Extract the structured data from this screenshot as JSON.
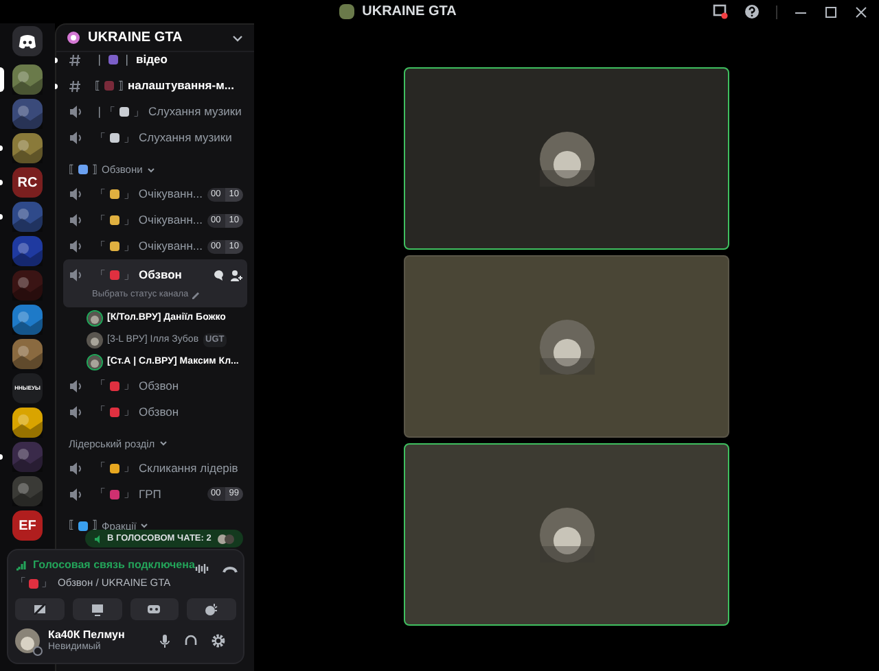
{
  "window": {
    "title": "UKRAINE GTA"
  },
  "servers": [
    {
      "kind": "home",
      "selected": false,
      "unread": false
    },
    {
      "kind": "art",
      "color": "#6a7a4a",
      "selected": true
    },
    {
      "kind": "art",
      "color": "#3a4a7a",
      "selected": false,
      "unread": false
    },
    {
      "kind": "art",
      "color": "#8a7a3a",
      "selected": false,
      "unread": true
    },
    {
      "kind": "label",
      "label": "RC",
      "color": "#7a1f1f",
      "selected": false,
      "unread": true
    },
    {
      "kind": "art",
      "color": "#2f4a8a",
      "selected": false,
      "unread": true
    },
    {
      "kind": "art",
      "color": "#1f3aa0",
      "selected": false,
      "unread": false
    },
    {
      "kind": "art",
      "color": "#3a1414",
      "selected": false,
      "unread": false
    },
    {
      "kind": "art",
      "color": "#1e7ac8",
      "selected": false,
      "unread": false
    },
    {
      "kind": "art",
      "color": "#8a6a40",
      "selected": false,
      "unread": false
    },
    {
      "kind": "label",
      "label": "ННЫЕУЫ",
      "color": "#1e1f22",
      "selected": false,
      "unread": false
    },
    {
      "kind": "art",
      "color": "#d9a400",
      "selected": false,
      "unread": false
    },
    {
      "kind": "art",
      "color": "#3a2a4a",
      "selected": false,
      "unread": true
    },
    {
      "kind": "art",
      "color": "#3a3a36",
      "selected": false,
      "unread": false
    },
    {
      "kind": "label",
      "label": "EF",
      "color": "#b01e1e",
      "selected": false,
      "unread": false
    }
  ],
  "guild": {
    "name": "UKRAINE GTA"
  },
  "channels": [
    {
      "kind": "text",
      "left": "❘",
      "color": "#7c5fc8",
      "right": "❘",
      "name": "відео",
      "unread": true
    },
    {
      "kind": "text",
      "left": "⟦",
      "color": "#7a2a3a",
      "right": "⟧",
      "name": "налаштування-м...",
      "unread": true
    },
    {
      "kind": "voice",
      "left": "❘「",
      "color": "#c9cdd3",
      "right": "」",
      "name": "Слухання музики"
    },
    {
      "kind": "voice",
      "left": "「",
      "color": "#c9cdd3",
      "right": "」",
      "name": "Слухання музики"
    },
    {
      "kind": "category",
      "left": "⟦",
      "color": "#6aa0f0",
      "right": "⟧",
      "name": "Обзвони"
    },
    {
      "kind": "voice",
      "left": "「",
      "color": "#e0b040",
      "right": "」",
      "name": "Очікуванн...",
      "counter": [
        "00",
        "10"
      ]
    },
    {
      "kind": "voice",
      "left": "「",
      "color": "#e0b040",
      "right": "」",
      "name": "Очікуванн...",
      "counter": [
        "00",
        "10"
      ]
    },
    {
      "kind": "voice",
      "left": "「",
      "color": "#e0b040",
      "right": "」",
      "name": "Очікуванн...",
      "counter": [
        "00",
        "10"
      ]
    },
    {
      "kind": "voice",
      "left": "「",
      "color": "#e03040",
      "right": "」",
      "name": "Обзвон",
      "selected": true,
      "status": "Выбрать статус канала"
    },
    {
      "kind": "member",
      "name": "[К/Тол.ВРУ] Даніїл Божко",
      "speaking": true
    },
    {
      "kind": "member",
      "name": "[3-L ВРУ] Ілля Зубов",
      "speaking": false,
      "tag": "UGT"
    },
    {
      "kind": "member",
      "name": "[Ст.А | Сл.ВРУ] Максим Кл...",
      "speaking": true
    },
    {
      "kind": "voice",
      "left": "「",
      "color": "#e03040",
      "right": "」",
      "name": "Обзвон"
    },
    {
      "kind": "voice",
      "left": "「",
      "color": "#e03040",
      "right": "」",
      "name": "Обзвон"
    },
    {
      "kind": "category",
      "name": "Лідерський розділ"
    },
    {
      "kind": "voice",
      "left": "「",
      "color": "#e8a820",
      "right": "」",
      "name": "Скликання лідерів"
    },
    {
      "kind": "voice",
      "left": "「",
      "color": "#d03070",
      "right": "」",
      "name": "ГРП",
      "counter": [
        "00",
        "99"
      ]
    },
    {
      "kind": "category",
      "left": "⟦",
      "color": "#3aa0f0",
      "right": "⟧",
      "name": "Фракції"
    }
  ],
  "voice_pill": {
    "text": "В ГОЛОСОВОМ ЧАТЕ: 2"
  },
  "voice_panel": {
    "status": "Голосовая связь подключена",
    "left": "「",
    "color": "#e03040",
    "right": "」",
    "channel": "Обзвон / UKRAINE GTA"
  },
  "user": {
    "name": "Ка40К Пелмун",
    "status": "Невидимый"
  },
  "tiles": [
    {
      "speaking": true,
      "color": "#282723"
    },
    {
      "speaking": false,
      "color": "#4a4636"
    },
    {
      "speaking": true,
      "color": "#3d3b32"
    }
  ]
}
